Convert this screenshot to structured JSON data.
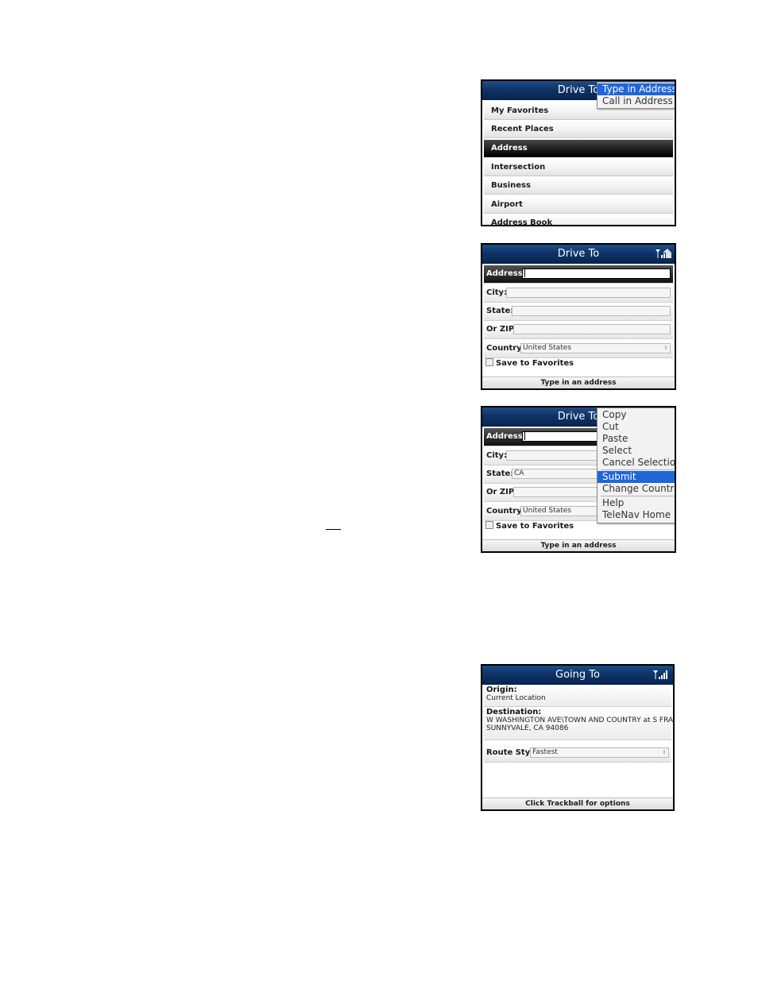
{
  "screen1": {
    "title": "Drive To",
    "menu_items": [
      "My Favorites",
      "Recent Places",
      "Address",
      "Intersection",
      "Business",
      "Airport",
      "Address Book"
    ],
    "selected_index": 2,
    "popup": [
      "Type in Address",
      "Call in Address"
    ],
    "popup_highlight": 0
  },
  "screen2": {
    "title": "Drive To",
    "fields": {
      "address_label": "Address:",
      "address_value": "",
      "city_label": "City:",
      "city_value": "",
      "state_label": "State:",
      "state_value": "",
      "zip_label": "Or ZIP:",
      "zip_value": "",
      "country_label": "Country:",
      "country_value": "United States"
    },
    "save_favorites": "Save to Favorites",
    "status": "Type in an address"
  },
  "screen3": {
    "title": "Drive To",
    "fields": {
      "address_label": "Address:",
      "address_value": "",
      "city_label": "City:",
      "city_value": "",
      "state_label": "State:",
      "state_value": "CA",
      "zip_label": "Or ZIP:",
      "zip_value": "",
      "country_label": "Country:",
      "country_value": "United States"
    },
    "save_favorites": "Save to Favorites",
    "status": "Type in an address",
    "context_menu": {
      "group1": [
        "Copy",
        "Cut",
        "Paste",
        "Select",
        "Cancel Selection"
      ],
      "group2": [
        "Submit",
        "Change Country"
      ],
      "group3": [
        "Help",
        "TeleNav Home"
      ],
      "highlight": "Submit"
    }
  },
  "screen4": {
    "title": "Going To",
    "origin_label": "Origin:",
    "origin_value": "Current Location",
    "destination_label": "Destination:",
    "destination_line1": "W WASHINGTON AVE\\TOWN AND COUNTRY at S FRANCE...",
    "destination_line2": "SUNNYVALE, CA 94086",
    "route_style_label": "Route Style:",
    "route_style_value": "Fastest",
    "status": "Click Trackball for options"
  },
  "colors": {
    "title_bar": "#0f3468",
    "highlight": "#1f66d8",
    "selected_row": "#222222"
  }
}
